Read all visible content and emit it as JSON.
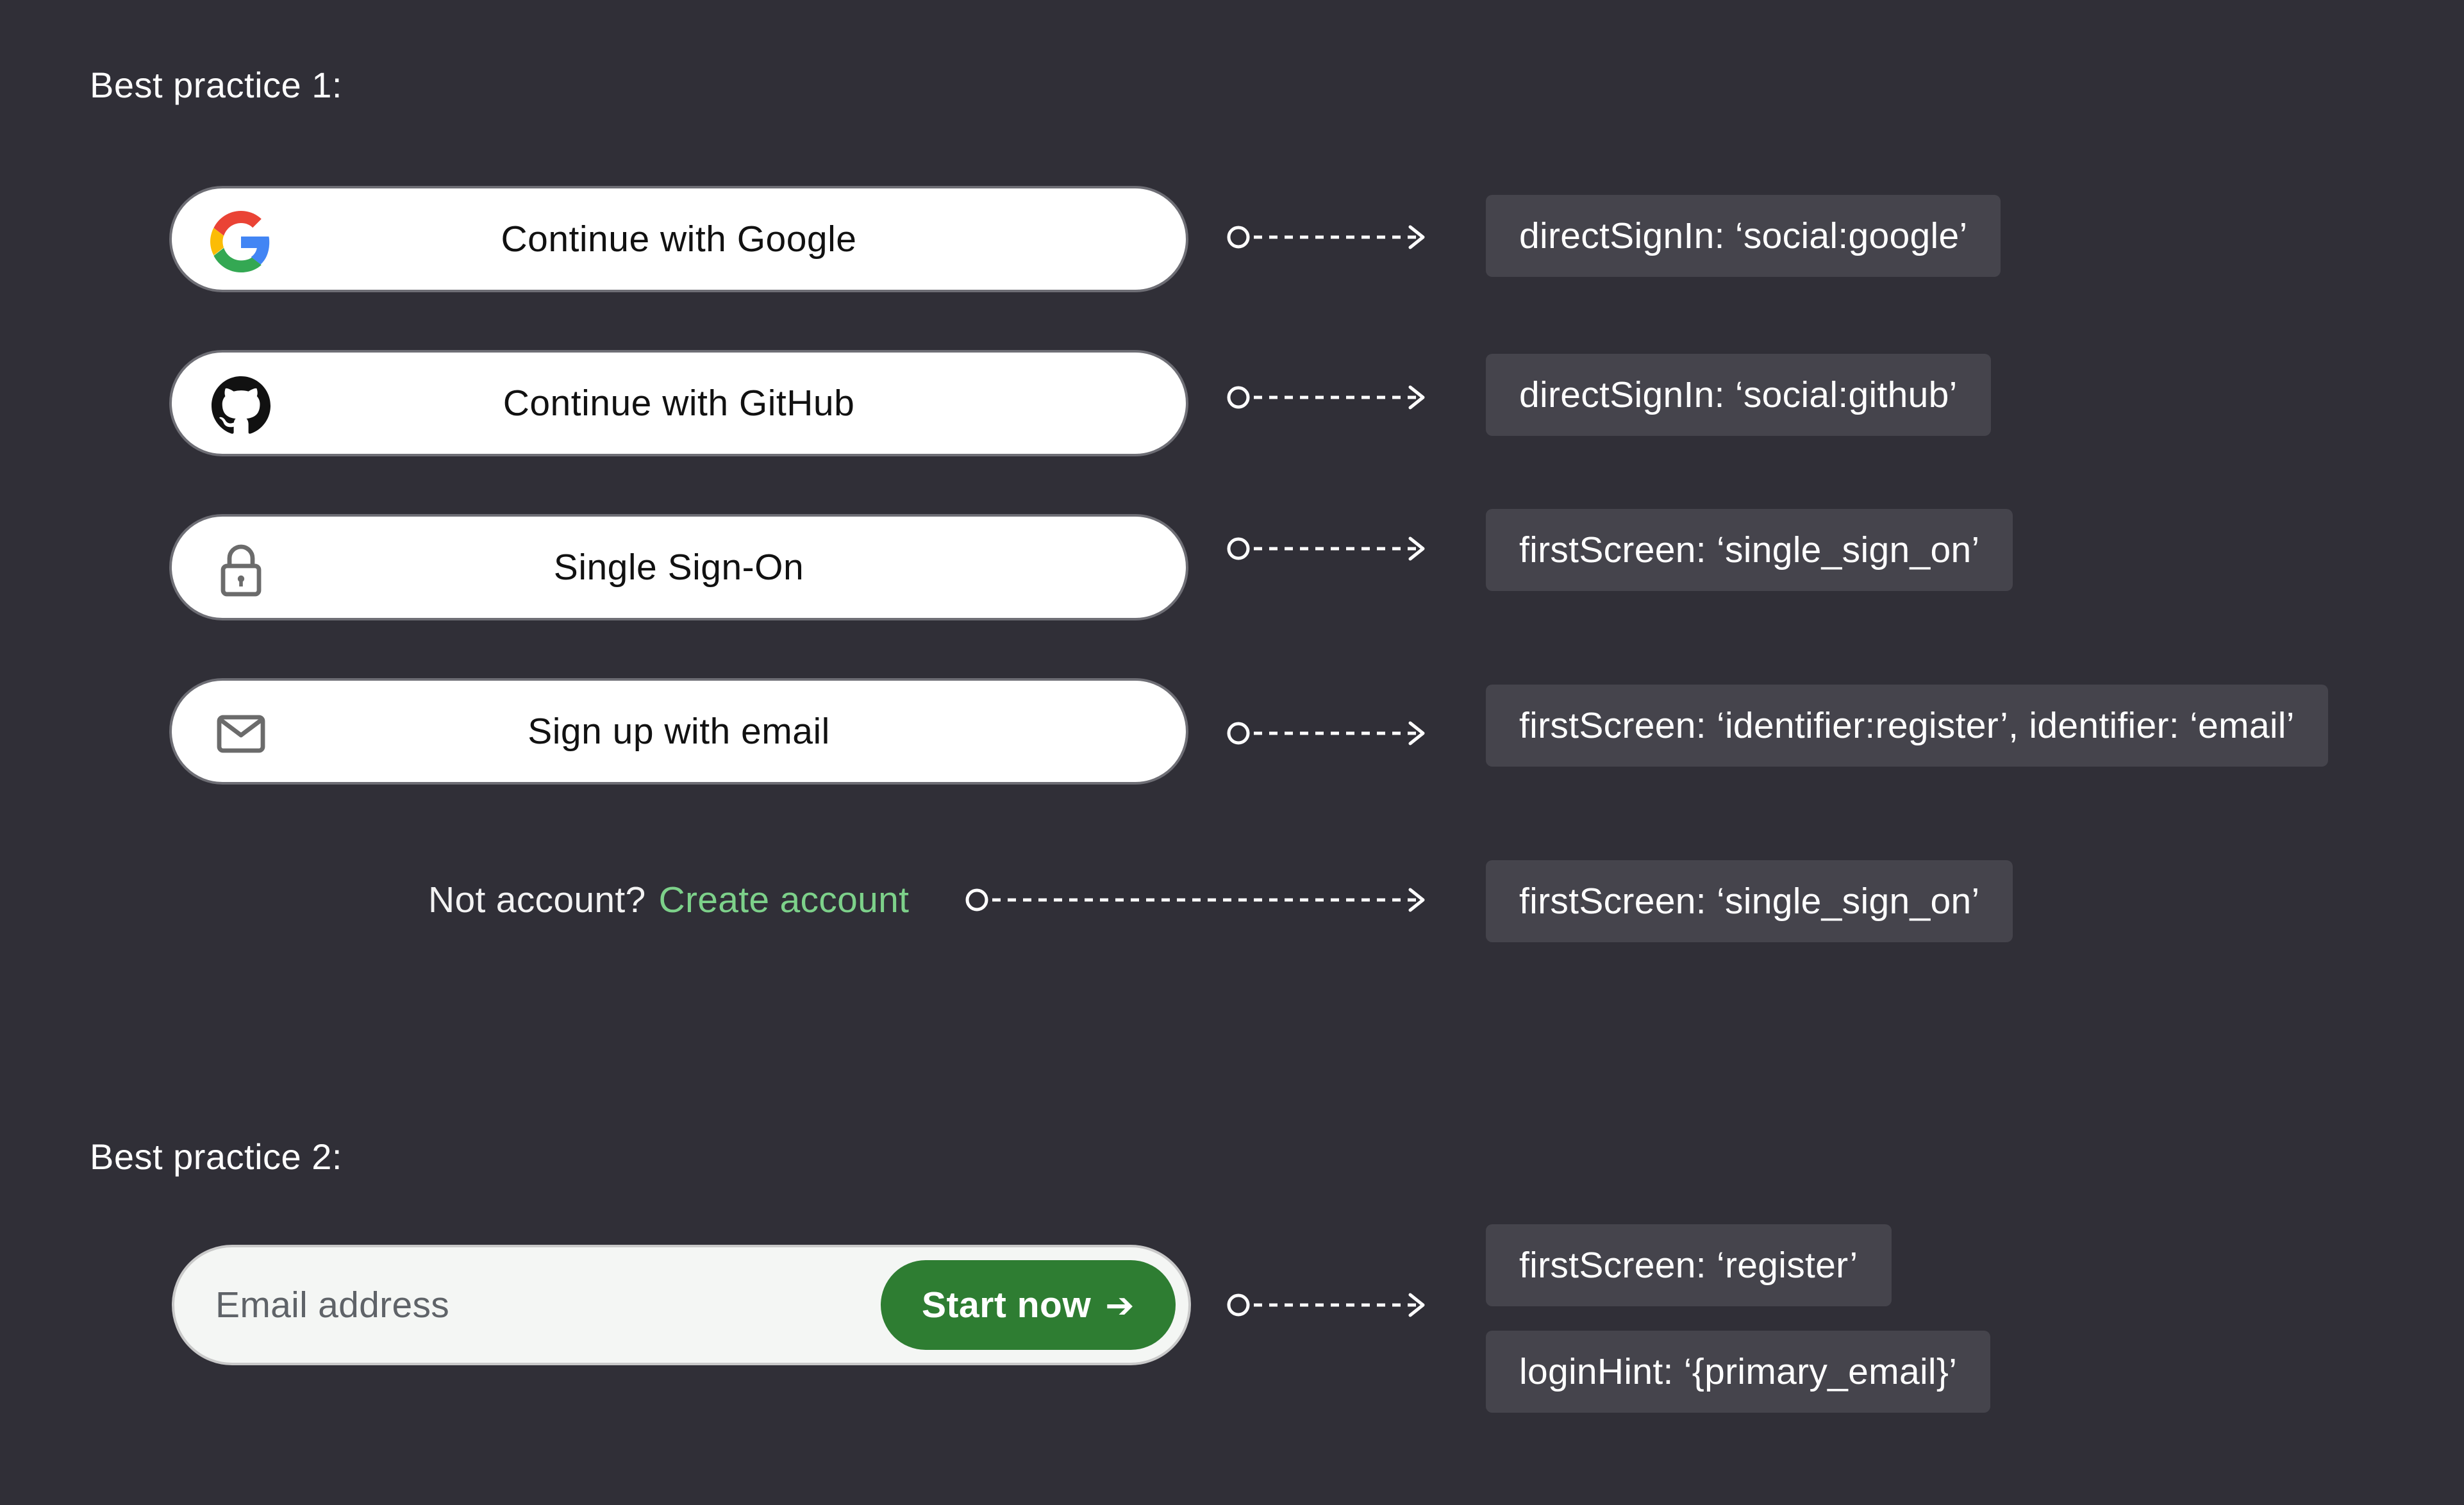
{
  "section1": {
    "heading": "Best practice 1:",
    "buttons": [
      {
        "label": "Continue with Google",
        "icon": "google-icon",
        "code": "directSignIn: ‘social:google’"
      },
      {
        "label": "Continue with GitHub",
        "icon": "github-icon",
        "code": "directSignIn: ‘social:github’"
      },
      {
        "label": "Single Sign-On",
        "icon": "lock-icon",
        "code": "firstScreen: ‘single_sign_on’"
      },
      {
        "label": "Sign up with email",
        "icon": "mail-icon",
        "code": "firstScreen: ‘identifier:register’, identifier: ‘email’"
      }
    ],
    "footer": {
      "prompt": "Not account?",
      "link": "Create account",
      "code": "firstScreen: ‘single_sign_on’"
    }
  },
  "section2": {
    "heading": "Best practice 2:",
    "email_placeholder": "Email address",
    "start_button": "Start now",
    "codes": [
      "firstScreen: ‘register’",
      "loginHint: ‘{primary_email}’"
    ]
  },
  "colors": {
    "background": "#302f37",
    "code_box": "#45444c",
    "link": "#7dd18a",
    "start_button": "#2e7d32"
  }
}
